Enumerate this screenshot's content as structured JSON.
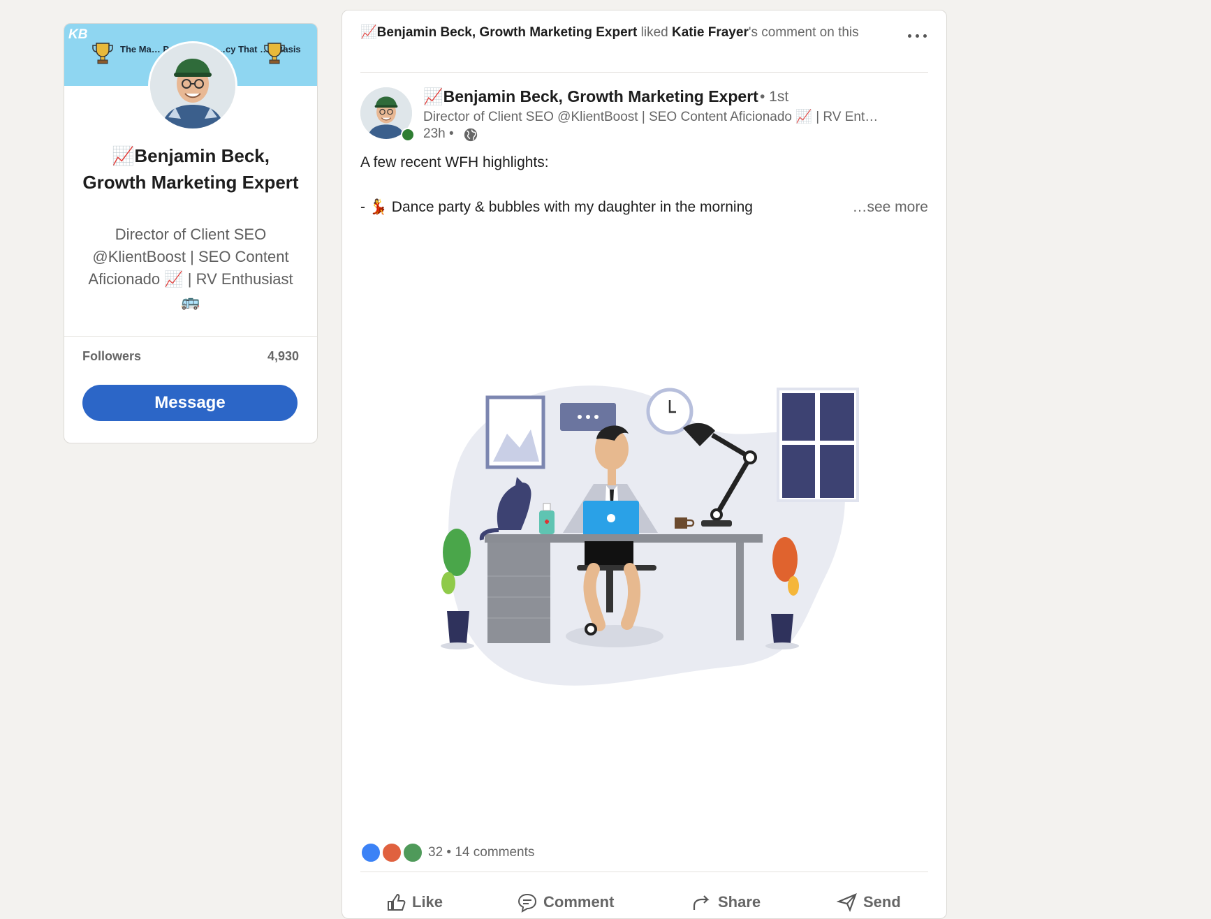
{
  "profile_card": {
    "banner_logo": "KB",
    "banner_left_text": "The Ma… Produc…",
    "banner_right_text": "…cy That …y Basis",
    "name": "📈Benjamin Beck, Growth Marketing Expert",
    "headline": "Director of Client SEO @KlientBoost | SEO Content Aficionado 📈 | RV Enthusiast 🚌",
    "followers_label": "Followers",
    "followers_value": "4,930",
    "message_label": "Message"
  },
  "post": {
    "activity_actor": "📈Benjamin Beck, Growth Marketing Expert",
    "activity_verb": " liked ",
    "activity_target": "Katie Frayer",
    "activity_suffix": "'s comment on this",
    "author_name": "📈Benjamin Beck, Growth Marketing Expert",
    "author_degree": "• 1st",
    "author_headline": "Director of Client SEO @KlientBoost | SEO Content Aficionado 📈 | RV Ent…",
    "time": "23h •",
    "text_line1": "A few recent WFH highlights:",
    "text_line2": "- 💃 Dance party & bubbles with my daughter in the morning",
    "see_more": "…see more",
    "reaction_count": "32",
    "comments_text": "• 14 comments",
    "reaction_icons": [
      "like-icon",
      "love-icon",
      "celebrate-icon"
    ],
    "actions": {
      "like": "Like",
      "comment": "Comment",
      "share": "Share",
      "send": "Send"
    }
  },
  "colors": {
    "page_bg": "#f3f2ef",
    "primary_button": "#2c66c7",
    "banner": "#8fd6f1",
    "online": "#2e7d32"
  }
}
